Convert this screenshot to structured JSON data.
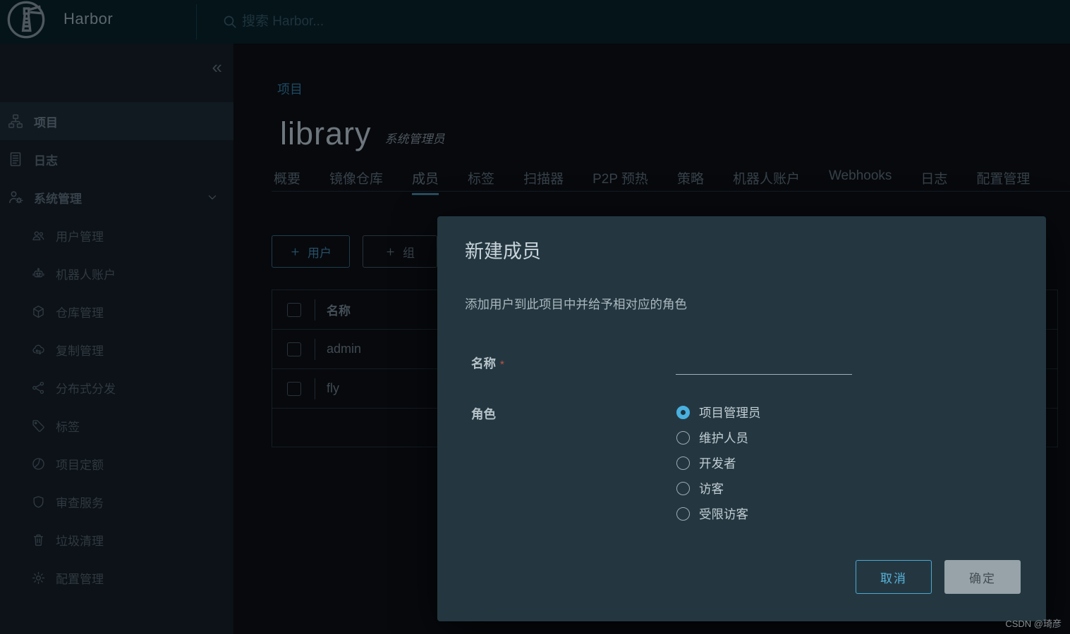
{
  "header": {
    "brand": "Harbor",
    "search_placeholder": "搜索 Harbor..."
  },
  "sidebar": {
    "items": [
      {
        "id": "projects",
        "label": "项目",
        "icon": "projects",
        "level": "top",
        "active": true
      },
      {
        "id": "logs",
        "label": "日志",
        "icon": "logs",
        "level": "top"
      },
      {
        "id": "system-admin",
        "label": "系统管理",
        "icon": "admin",
        "level": "top",
        "expanded": true
      },
      {
        "id": "user-management",
        "label": "用户管理",
        "icon": "users",
        "level": "sub"
      },
      {
        "id": "robot-accounts",
        "label": "机器人账户",
        "icon": "robot",
        "level": "sub"
      },
      {
        "id": "registry-management",
        "label": "仓库管理",
        "icon": "cube",
        "level": "sub"
      },
      {
        "id": "replication-management",
        "label": "复制管理",
        "icon": "replication",
        "level": "sub"
      },
      {
        "id": "distribution",
        "label": "分布式分发",
        "icon": "share",
        "level": "sub"
      },
      {
        "id": "labels",
        "label": "标签",
        "icon": "tag",
        "level": "sub"
      },
      {
        "id": "project-quotas",
        "label": "项目定额",
        "icon": "quota",
        "level": "sub"
      },
      {
        "id": "interrogation-services",
        "label": "审查服务",
        "icon": "shield",
        "level": "sub"
      },
      {
        "id": "garbage-collection",
        "label": "垃圾清理",
        "icon": "trash",
        "level": "sub"
      },
      {
        "id": "configuration",
        "label": "配置管理",
        "icon": "gear",
        "level": "sub"
      }
    ]
  },
  "main": {
    "breadcrumb": "项目",
    "project_title": "library",
    "project_role": "系统管理员",
    "tabs": [
      {
        "id": "summary",
        "label": "概要"
      },
      {
        "id": "repositories",
        "label": "镜像仓库"
      },
      {
        "id": "members",
        "label": "成员",
        "active": true
      },
      {
        "id": "labels",
        "label": "标签"
      },
      {
        "id": "scanner",
        "label": "扫描器"
      },
      {
        "id": "p2p-preheat",
        "label": "P2P 预热"
      },
      {
        "id": "policy",
        "label": "策略"
      },
      {
        "id": "robot-accounts",
        "label": "机器人账户"
      },
      {
        "id": "webhooks",
        "label": "Webhooks"
      },
      {
        "id": "logs",
        "label": "日志"
      },
      {
        "id": "configuration",
        "label": "配置管理"
      }
    ],
    "toolbar": {
      "add_user_label": "用户",
      "add_group_label": "组"
    },
    "table": {
      "name_header": "名称",
      "rows": [
        {
          "name": "admin"
        },
        {
          "name": "fly"
        }
      ]
    }
  },
  "modal": {
    "title": "新建成员",
    "description": "添加用户到此项目中并给予相对应的角色",
    "name_label": "名称",
    "required_marker": "*",
    "name_value": "",
    "role_label": "角色",
    "role_options": [
      {
        "label": "项目管理员",
        "selected": true
      },
      {
        "label": "维护人员"
      },
      {
        "label": "开发者"
      },
      {
        "label": "访客"
      },
      {
        "label": "受限访客"
      }
    ],
    "cancel_label": "取消",
    "ok_label": "确定"
  },
  "watermark": "CSDN @琦彦",
  "colors": {
    "accent_blue": "#49b0e0",
    "modal_bg": "#243741",
    "required_red": "#c2524a",
    "disabled_button": "#97a3a9"
  }
}
